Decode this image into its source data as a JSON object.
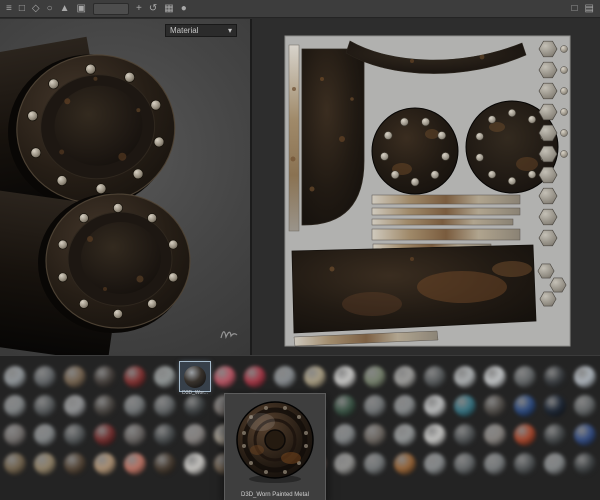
{
  "toolbar": {
    "left_icons": [
      {
        "name": "menu-icon",
        "glyph": "≡"
      },
      {
        "name": "select-tool-icon",
        "glyph": "□"
      },
      {
        "name": "paint-tool-icon",
        "glyph": "◇"
      },
      {
        "name": "eraser-tool-icon",
        "glyph": "○"
      },
      {
        "name": "projection-tool-icon",
        "glyph": "▲"
      },
      {
        "name": "fill-tool-icon",
        "glyph": "▣"
      }
    ],
    "more_icons": [
      {
        "name": "add-icon",
        "glyph": "+"
      },
      {
        "name": "rotate-view-icon",
        "glyph": "↺"
      },
      {
        "name": "grid-icon",
        "glyph": "▦"
      },
      {
        "name": "render-icon",
        "glyph": "●"
      }
    ],
    "right_icons": [
      {
        "name": "panel-icon",
        "glyph": "□"
      },
      {
        "name": "list-icon",
        "glyph": "▤"
      }
    ]
  },
  "viewport3d": {
    "material_dropdown": {
      "label": "Material",
      "chevron": "▾"
    }
  },
  "shelf": {
    "selected": {
      "row": 0,
      "col": 6,
      "caption": "D3D_Wor..."
    },
    "popup": {
      "caption": "D3D_Worn Painted Metal"
    },
    "rows": [
      [
        "#9aa0a4",
        "#6b6f72",
        "#7d6a55",
        "#4a4440",
        "#8a3434",
        "#9aa0a0",
        "#38322c",
        "#c65a6a",
        "#b03a4a",
        "#8f9498",
        "#b5a98c",
        "#d6d6d4",
        "#7e8a74",
        "#a8a8a6",
        "#5e6264",
        "#b8bcbe",
        "#cfd2d4",
        "#6a6e70",
        "#3e4246",
        "#b8c0c8"
      ],
      [
        "#8a8e90",
        "#5f6365",
        "#9a9c9e",
        "#4e4a46",
        "#7a7e80",
        "#6a6e70",
        "#44484a",
        "#8a8480",
        "#b0b4b6",
        "#6e6a66",
        "#565a5c",
        "#3e5a4a",
        "#7a7e80",
        "#8e9294",
        "#c8cacb",
        "#3a7a8a",
        "#56524e",
        "#2e4e86",
        "#1f2a3a",
        "#6a6e70"
      ],
      [
        "#7a7674",
        "#8a8e90",
        "#5a5e60",
        "#7a3030",
        "#6e6a68",
        "#4e5254",
        "#8e8a88",
        "#b0a89a",
        "#6a6e70",
        "#7e8284",
        "#5e6264",
        "#8a8e90",
        "#746e68",
        "#9a9e9f",
        "#d2d2d0",
        "#565a5c",
        "#8e8a86",
        "#b04a2e",
        "#4a4e50",
        "#35508a"
      ],
      [
        "#7a6a52",
        "#9a8a6e",
        "#5a4a3a",
        "#b89a7a",
        "#c87a6a",
        "#4a3e32",
        "#d6d4d0",
        "#7a6a58",
        "#8a8a88",
        "#6e6e6c",
        "#c8a090",
        "#9a9a98",
        "#7a7e80",
        "#a06a3a",
        "#8e9294",
        "#6a6e70",
        "#7e8284",
        "#565a5c",
        "#8a8e90",
        "#44484a"
      ]
    ]
  }
}
